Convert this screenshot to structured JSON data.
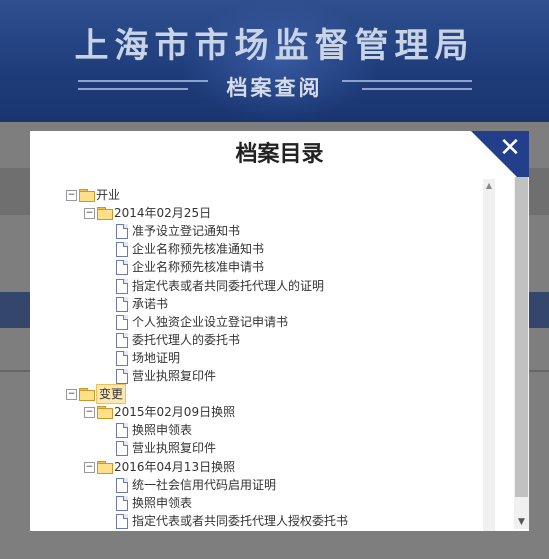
{
  "header": {
    "title": "上海市市场监督管理局",
    "subtitle": "档案查阅"
  },
  "modal": {
    "title": "档案目录",
    "close_label": "✕"
  },
  "tree": [
    {
      "level": 0,
      "type": "folder",
      "toggle": "⊟",
      "label": "开业"
    },
    {
      "level": 1,
      "type": "folder",
      "toggle": "⊟",
      "label": "2014年02月25日"
    },
    {
      "level": 2,
      "type": "doc",
      "label": "准予设立登记通知书"
    },
    {
      "level": 2,
      "type": "doc",
      "label": "企业名称预先核准通知书"
    },
    {
      "level": 2,
      "type": "doc",
      "label": "企业名称预先核准申请书"
    },
    {
      "level": 2,
      "type": "doc",
      "label": "指定代表或者共同委托代理人的证明"
    },
    {
      "level": 2,
      "type": "doc",
      "label": "承诺书"
    },
    {
      "level": 2,
      "type": "doc",
      "label": "个人独资企业设立登记申请书"
    },
    {
      "level": 2,
      "type": "doc",
      "label": "委托代理人的委托书"
    },
    {
      "level": 2,
      "type": "doc",
      "label": "场地证明"
    },
    {
      "level": 2,
      "type": "doc",
      "label": "营业执照复印件"
    },
    {
      "level": 0,
      "type": "folder",
      "toggle": "⊟",
      "label": "变更",
      "selected": true
    },
    {
      "level": 1,
      "type": "folder",
      "toggle": "⊟",
      "label": "2015年02月09日换照"
    },
    {
      "level": 2,
      "type": "doc",
      "label": "换照申领表"
    },
    {
      "level": 2,
      "type": "doc",
      "label": "营业执照复印件"
    },
    {
      "level": 1,
      "type": "folder",
      "toggle": "⊟",
      "label": "2016年04月13日换照"
    },
    {
      "level": 2,
      "type": "doc",
      "label": "统一社会信用代码启用证明"
    },
    {
      "level": 2,
      "type": "doc",
      "label": "换照申领表"
    },
    {
      "level": 2,
      "type": "doc",
      "label": "指定代表或者共同委托代理人授权委托书"
    }
  ]
}
